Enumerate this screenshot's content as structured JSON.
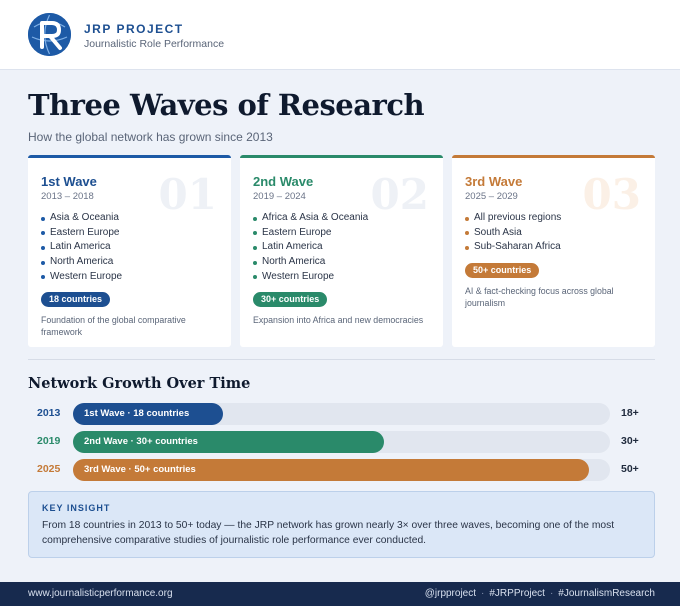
{
  "brand": {
    "name": "JRP PROJECT",
    "subtitle": "Journalistic Role Performance",
    "logo_glyph": "R"
  },
  "page": {
    "title": "Three Waves of Research",
    "subtitle": "How the global network has grown since 2013"
  },
  "waves": [
    {
      "number": "01",
      "name": "1st Wave",
      "years": "2013 – 2018",
      "regions": [
        "Asia & Oceania",
        "Eastern Europe",
        "Latin America",
        "North America",
        "Western Europe"
      ],
      "badge": "18 countries",
      "description": "Foundation of the global comparative framework",
      "color": "#1d4f91"
    },
    {
      "number": "02",
      "name": "2nd Wave",
      "years": "2019 – 2024",
      "regions": [
        "Africa & Asia & Oceania",
        "Eastern Europe",
        "Latin America",
        "North America",
        "Western Europe"
      ],
      "badge": "30+ countries",
      "description": "Expansion into Africa and new democracies",
      "color": "#2a8a6a"
    },
    {
      "number": "03",
      "name": "3rd Wave",
      "years": "2025 – 2029",
      "regions": [
        "All previous regions",
        "South Asia",
        "Sub-Saharan Africa"
      ],
      "badge": "50+ countries",
      "description": "AI & fact-checking focus across global journalism",
      "color": "#c47a38"
    }
  ],
  "growth": {
    "title": "Network Growth Over Time",
    "rows": [
      {
        "year": "2013",
        "label": "1st Wave · 18 countries",
        "total": "18+",
        "fraction": 0.28,
        "color": "#1d4f91"
      },
      {
        "year": "2019",
        "label": "2nd Wave · 30+ countries",
        "total": "30+",
        "fraction": 0.58,
        "color": "#2a8a6a"
      },
      {
        "year": "2025",
        "label": "3rd Wave · 50+ countries",
        "total": "50+",
        "fraction": 0.96,
        "color": "#c47a38"
      }
    ]
  },
  "insight": {
    "heading": "KEY INSIGHT",
    "body": "From 18 countries in 2013 to 50+ today — the JRP network has grown nearly 3× over three waves, becoming one of the most comprehensive comparative studies of journalistic role performance ever conducted."
  },
  "footer": {
    "url": "www.journalisticperformance.org",
    "tags": [
      "@jrpproject",
      "#JRPProject",
      "#JournalismResearch"
    ]
  }
}
